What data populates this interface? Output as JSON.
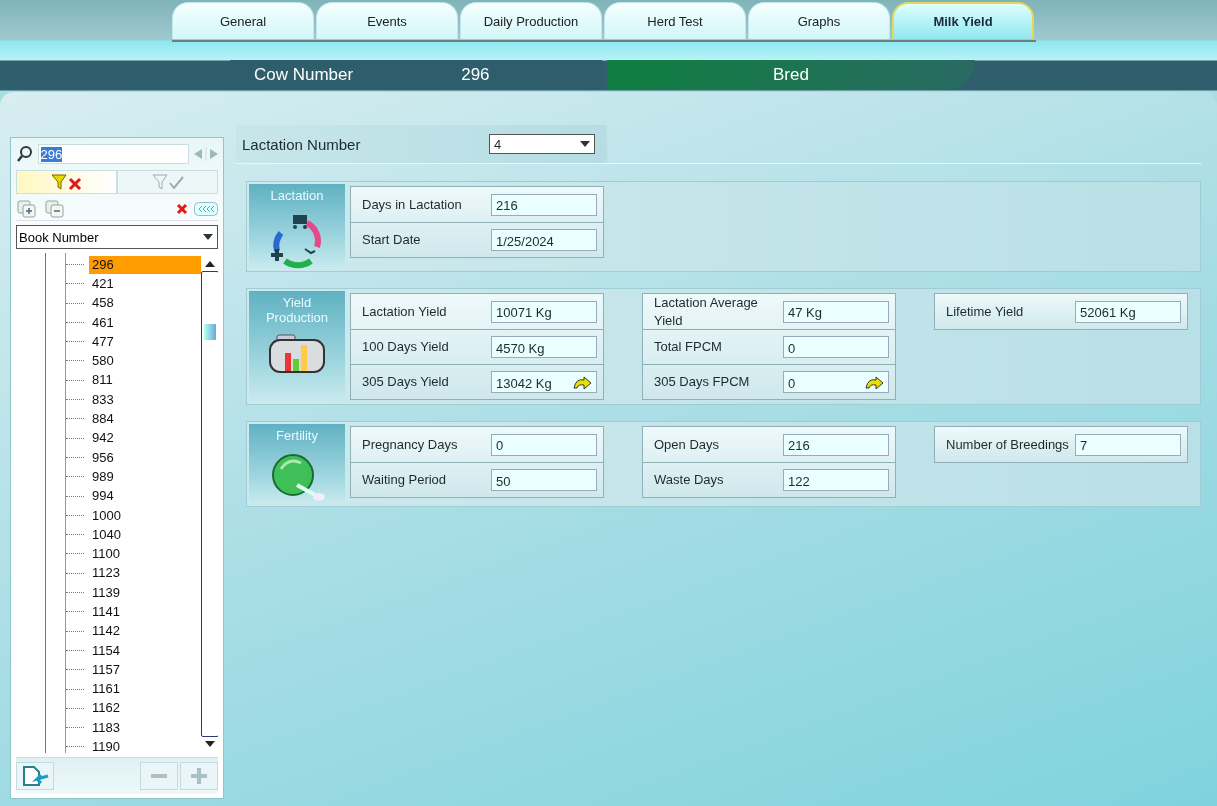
{
  "tabs": [
    {
      "label": "General",
      "selected": false
    },
    {
      "label": "Events",
      "selected": false
    },
    {
      "label": "Daily Production",
      "selected": false
    },
    {
      "label": "Herd Test",
      "selected": false
    },
    {
      "label": "Graphs",
      "selected": false
    },
    {
      "label": "Milk Yield",
      "selected": true
    }
  ],
  "header": {
    "cow_number_label": "Cow Number",
    "cow_number": "296",
    "status": "Bred"
  },
  "sidebar": {
    "search_value": "296",
    "sort_field": "Book Number",
    "cow_list": [
      {
        "label": "296",
        "selected": true
      },
      {
        "label": "421",
        "selected": false
      },
      {
        "label": "458",
        "selected": false
      },
      {
        "label": "461",
        "selected": false
      },
      {
        "label": "477",
        "selected": false
      },
      {
        "label": "580",
        "selected": false
      },
      {
        "label": "811",
        "selected": false
      },
      {
        "label": "833",
        "selected": false
      },
      {
        "label": "884",
        "selected": false
      },
      {
        "label": "942",
        "selected": false
      },
      {
        "label": "956",
        "selected": false
      },
      {
        "label": "989",
        "selected": false
      },
      {
        "label": "994",
        "selected": false
      },
      {
        "label": "1000",
        "selected": false
      },
      {
        "label": "1040",
        "selected": false
      },
      {
        "label": "1100",
        "selected": false
      },
      {
        "label": "1123",
        "selected": false
      },
      {
        "label": "1139",
        "selected": false
      },
      {
        "label": "1141",
        "selected": false
      },
      {
        "label": "1142",
        "selected": false
      },
      {
        "label": "1154",
        "selected": false
      },
      {
        "label": "1157",
        "selected": false
      },
      {
        "label": "1161",
        "selected": false
      },
      {
        "label": "1162",
        "selected": false
      },
      {
        "label": "1183",
        "selected": false
      },
      {
        "label": "1190",
        "selected": false
      }
    ]
  },
  "lactation_number": {
    "label": "Lactation Number",
    "value": "4"
  },
  "sections": [
    {
      "kind": "lactation",
      "title": "Lactation",
      "columns": [
        {
          "fields": [
            {
              "label": "Days in Lactation",
              "value": "216",
              "action": false
            },
            {
              "label": "Start Date",
              "value": "1/25/2024",
              "action": false
            }
          ]
        }
      ]
    },
    {
      "kind": "yield",
      "title": "Yield Production",
      "columns": [
        {
          "fields": [
            {
              "label": "Lactation Yield",
              "value": "10071 Kg",
              "action": false
            },
            {
              "label": "100 Days Yield",
              "value": "4570 Kg",
              "action": false
            },
            {
              "label": "305 Days Yield",
              "value": "13042 Kg",
              "action": true
            }
          ]
        },
        {
          "fields": [
            {
              "label": "Lactation Average Yield",
              "value": "47 Kg",
              "action": false
            },
            {
              "label": "Total FPCM",
              "value": "0",
              "action": false
            },
            {
              "label": "305 Days FPCM",
              "value": "0",
              "action": true
            }
          ]
        },
        {
          "fields": [
            {
              "label": "Lifetime Yield",
              "value": "52061 Kg",
              "action": false
            }
          ]
        }
      ]
    },
    {
      "kind": "fertility",
      "title": "Fertility",
      "columns": [
        {
          "fields": [
            {
              "label": "Pregnancy Days",
              "value": "0",
              "action": false
            },
            {
              "label": "Waiting Period",
              "value": "50",
              "action": false
            }
          ]
        },
        {
          "fields": [
            {
              "label": "Open Days",
              "value": "216",
              "action": false
            },
            {
              "label": "Waste Days",
              "value": "122",
              "action": false
            }
          ]
        },
        {
          "fields": [
            {
              "label": "Number of Breedings",
              "value": "7",
              "action": false
            }
          ]
        }
      ]
    }
  ]
}
